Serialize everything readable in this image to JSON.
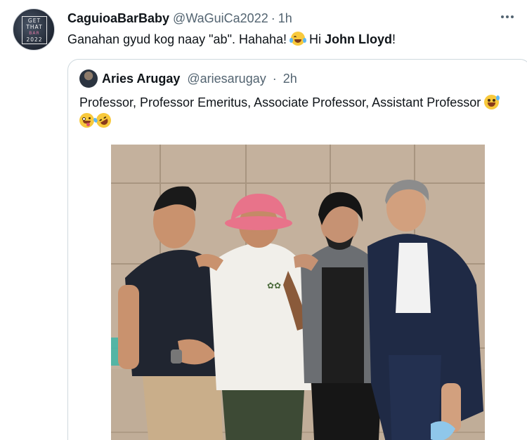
{
  "tweet": {
    "display_name": "CaguioaBarBaby",
    "handle": "@WaGuiCa2022",
    "separator": "·",
    "time": "1h",
    "text_before": "Ganahan gyud kog naay \"ab\". Hahaha! ",
    "emoji_1": "face-with-tears-of-joy",
    "text_hi": " Hi ",
    "text_bold": "John Lloyd",
    "text_end": "!",
    "avatar_lines": [
      "GET",
      "THAT",
      "BAR",
      "2022"
    ]
  },
  "quote": {
    "display_name": "Aries Arugay",
    "handle": "@ariesarugay",
    "separator": "·",
    "time": "2h",
    "text": "Professor, Professor Emeritus, Associate Professor, Assistant Professor",
    "emojis": [
      "grinning-face-with-sweat",
      "zany-face",
      "rolling-on-the-floor-laughing"
    ]
  },
  "photo": {
    "subject": "four-men-group-photo"
  },
  "colors": {
    "text": "#0f1419",
    "muted": "#536471",
    "border": "#cfd9de",
    "background": "#ffffff"
  }
}
